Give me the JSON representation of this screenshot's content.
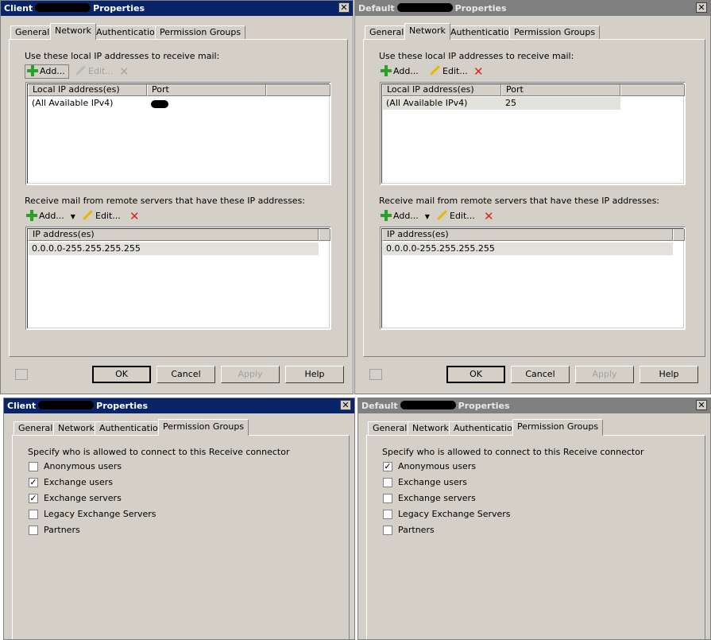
{
  "tabs": [
    "General",
    "Network",
    "Authentication",
    "Permission Groups"
  ],
  "win_client_network": {
    "title_prefix": "Client",
    "title_suffix": "Properties",
    "local_label": "Use these local IP addresses to receive mail:",
    "add_label": "Add...",
    "edit_label": "Edit...",
    "col_local": "Local IP address(es)",
    "col_port": "Port",
    "row_ip": "(All Available IPv4)",
    "row_port": "",
    "remote_label": "Receive mail from remote servers that have these IP addresses:",
    "col_ip": "IP address(es)",
    "remote_row": "0.0.0.0-255.255.255.255",
    "ok": "OK",
    "cancel": "Cancel",
    "apply": "Apply",
    "help": "Help"
  },
  "win_default_network": {
    "title_prefix": "Default",
    "title_suffix": "Properties",
    "local_label": "Use these local IP addresses to receive mail:",
    "add_label": "Add...",
    "edit_label": "Edit...",
    "col_local": "Local IP address(es)",
    "col_port": "Port",
    "row_ip": "(All Available IPv4)",
    "row_port": "25",
    "remote_label": "Receive mail from remote servers that have these IP addresses:",
    "col_ip": "IP address(es)",
    "remote_row": "0.0.0.0-255.255.255.255",
    "ok": "OK",
    "cancel": "Cancel",
    "apply": "Apply",
    "help": "Help"
  },
  "win_client_perm": {
    "title_prefix": "Client",
    "title_suffix": "Properties",
    "specify": "Specify who is allowed to connect to this Receive connector",
    "items": [
      {
        "label": "Anonymous users",
        "checked": false
      },
      {
        "label": "Exchange users",
        "checked": true
      },
      {
        "label": "Exchange servers",
        "checked": true
      },
      {
        "label": "Legacy Exchange Servers",
        "checked": false
      },
      {
        "label": "Partners",
        "checked": false
      }
    ]
  },
  "win_default_perm": {
    "title_prefix": "Default",
    "title_suffix": "Properties",
    "specify": "Specify who is allowed to connect to this Receive connector",
    "items": [
      {
        "label": "Anonymous users",
        "checked": true
      },
      {
        "label": "Exchange users",
        "checked": false
      },
      {
        "label": "Exchange servers",
        "checked": false
      },
      {
        "label": "Legacy Exchange Servers",
        "checked": false
      },
      {
        "label": "Partners",
        "checked": false
      }
    ]
  },
  "colors": {
    "active_title": "#0a246a",
    "inactive_title": "#808080",
    "dialog": "#d4d0c8",
    "add_icon": "#2aa02a",
    "delete_icon": "#e02020"
  },
  "icons": [
    "close-icon",
    "add-icon",
    "edit-icon",
    "delete-icon",
    "dropdown-arrow-icon",
    "properties-icon",
    "checkmark-icon"
  ]
}
